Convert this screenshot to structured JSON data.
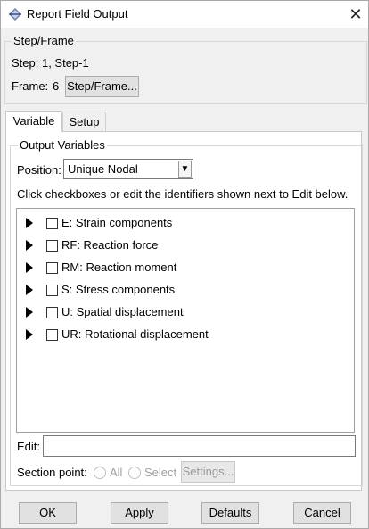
{
  "window": {
    "title": "Report Field Output",
    "close_glyph": "✕"
  },
  "step_frame": {
    "group_label": "Step/Frame",
    "step_text": "Step: 1, Step-1",
    "frame_label": "Frame:",
    "frame_value": "6",
    "button_label": "Step/Frame..."
  },
  "tabs": [
    {
      "label": "Variable",
      "active": true
    },
    {
      "label": "Setup",
      "active": false
    }
  ],
  "output_variables": {
    "group_label": "Output Variables",
    "position_label": "Position:",
    "position_value": "Unique Nodal",
    "hint": "Click checkboxes or edit the identifiers shown next to Edit below.",
    "items": [
      {
        "label": "E: Strain components",
        "checked": false
      },
      {
        "label": "RF: Reaction force",
        "checked": false
      },
      {
        "label": "RM: Reaction moment",
        "checked": false
      },
      {
        "label": "S: Stress components",
        "checked": false
      },
      {
        "label": "U: Spatial displacement",
        "checked": false
      },
      {
        "label": "UR: Rotational displacement",
        "checked": false
      }
    ],
    "edit_label": "Edit:",
    "edit_value": "",
    "section_point_label": "Section point:",
    "radio_all": "All",
    "radio_select": "Select",
    "settings_button": "Settings..."
  },
  "footer": {
    "ok": "OK",
    "apply": "Apply",
    "defaults": "Defaults",
    "cancel": "Cancel"
  },
  "colors": {
    "window_bg": "#f0f0f0",
    "panel_bg": "#ffffff",
    "button_bg": "#e1e1e1"
  }
}
